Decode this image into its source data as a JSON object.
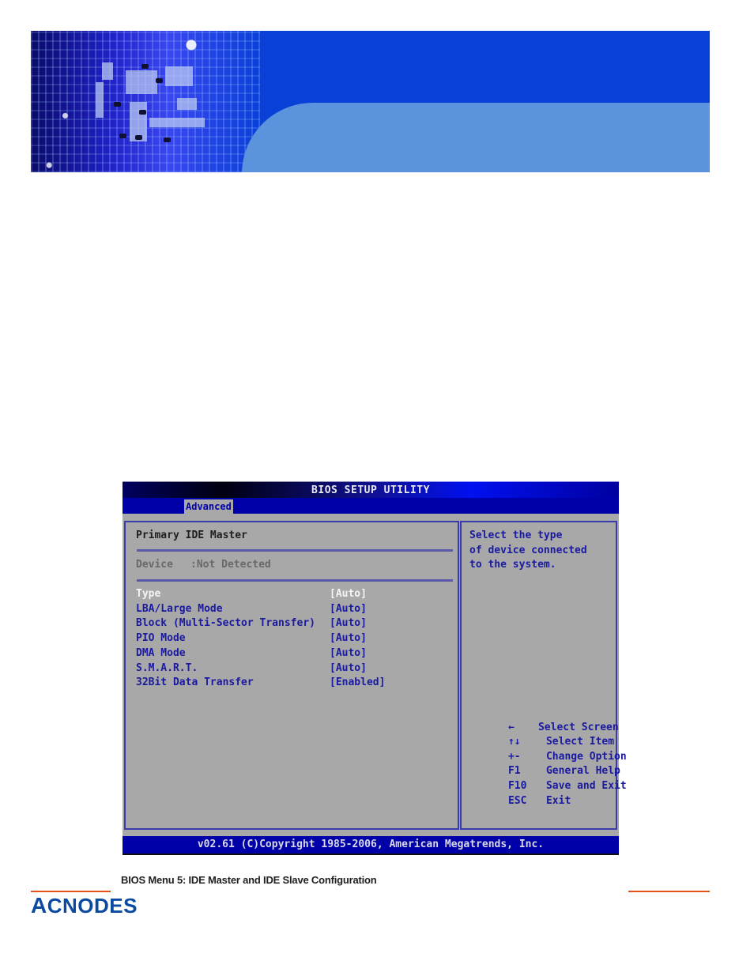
{
  "banner": {
    "image": "circuit-board-banner"
  },
  "bios": {
    "title": "BIOS SETUP UTILITY",
    "active_tab": "Advanced",
    "section_title": "Primary IDE Master",
    "device_label": "Device",
    "device_value": ":Not Detected",
    "settings": [
      {
        "label": "Type",
        "value": "[Auto]",
        "selected": true
      },
      {
        "label": "LBA/Large Mode",
        "value": "[Auto]",
        "selected": false
      },
      {
        "label": "Block (Multi-Sector Transfer)",
        "value": "[Auto]",
        "selected": false
      },
      {
        "label": "PIO Mode",
        "value": "[Auto]",
        "selected": false
      },
      {
        "label": "DMA Mode",
        "value": "[Auto]",
        "selected": false
      },
      {
        "label": "S.M.A.R.T.",
        "value": "[Auto]",
        "selected": false
      },
      {
        "label": "32Bit Data Transfer",
        "value": "[Enabled]",
        "selected": false
      }
    ],
    "help_lines": [
      "Select the type",
      "of device connected",
      "to the system."
    ],
    "keys": [
      {
        "key": "←",
        "action": "Select Screen"
      },
      {
        "key": "↑↓",
        "action": "Select Item"
      },
      {
        "key": "+-",
        "action": "Change Option"
      },
      {
        "key": "F1",
        "action": "General Help"
      },
      {
        "key": "F10",
        "action": "Save and Exit"
      },
      {
        "key": "ESC",
        "action": "Exit"
      }
    ],
    "footer": "v02.61 (C)Copyright 1985-2006, American Megatrends, Inc."
  },
  "caption": "BIOS Menu 5: IDE Master and IDE Slave Configuration",
  "logo": {
    "first": "A",
    "rest": "CNODES"
  },
  "colors": {
    "accent_rule": "#e8501a",
    "logo": "#0a4aa0",
    "bios_blue": "#0000a8",
    "bios_grey": "#a8a8a8"
  }
}
